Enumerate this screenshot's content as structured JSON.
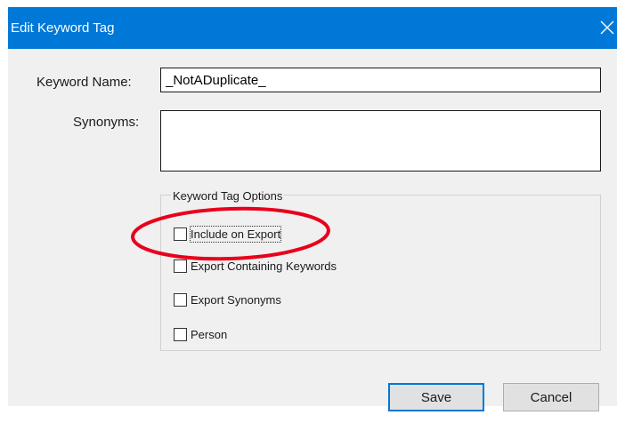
{
  "window": {
    "title": "Edit Keyword Tag",
    "close_glyph": "✕"
  },
  "form": {
    "keyword_name_label": "Keyword Name:",
    "keyword_name_value": "_NotADuplicate_",
    "synonyms_label": "Synonyms:",
    "synonyms_value": ""
  },
  "options": {
    "group_label": "Keyword Tag Options",
    "items": [
      {
        "label": "Include on Export",
        "checked": false
      },
      {
        "label": "Export Containing Keywords",
        "checked": false
      },
      {
        "label": "Export Synonyms",
        "checked": false
      },
      {
        "label": "Person",
        "checked": false
      }
    ]
  },
  "buttons": {
    "save_label": "Save",
    "cancel_label": "Cancel"
  },
  "colors": {
    "titlebar": "#0078d7",
    "dialog_background": "#f0f0f0",
    "default_button_border": "#0078d7",
    "annotation_circle": "#e8001c"
  },
  "icons": {
    "close": "close-icon",
    "annotation": "red-ellipse-annotation"
  }
}
